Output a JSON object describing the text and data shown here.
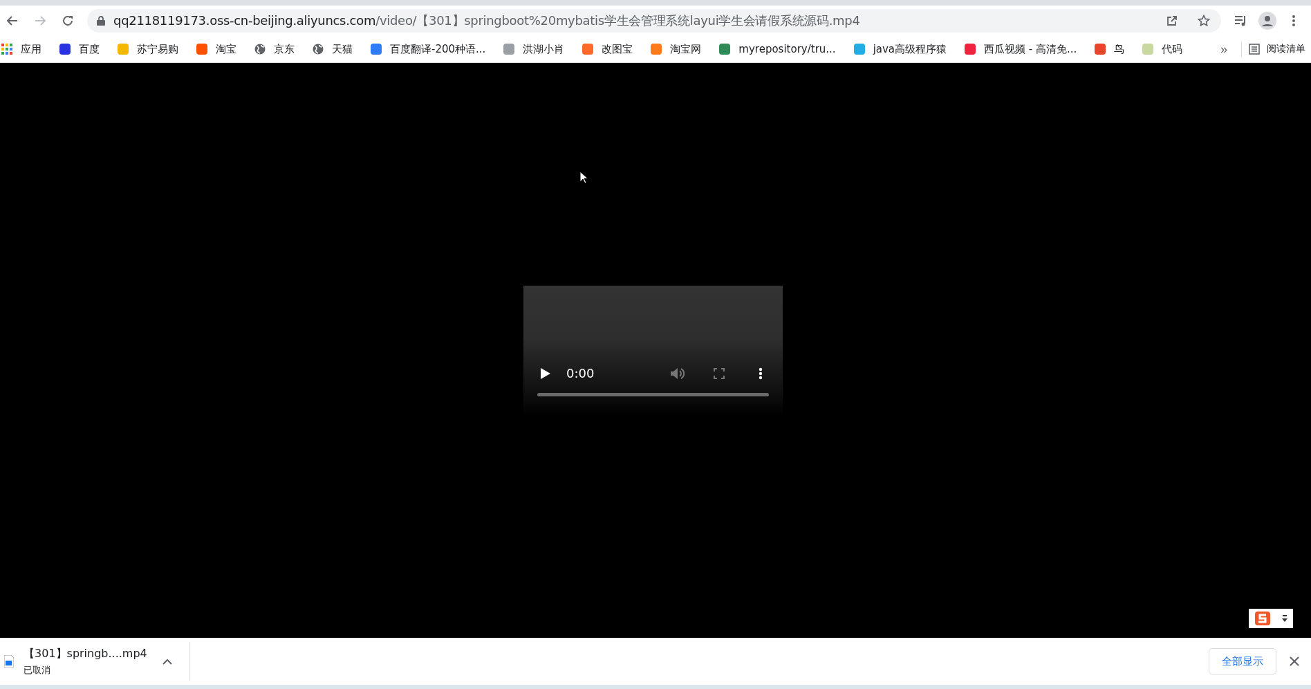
{
  "toolbar": {
    "nav_buttons": [
      {
        "kind": "back",
        "disabled": false
      },
      {
        "kind": "forward",
        "disabled": true
      },
      {
        "kind": "reload",
        "disabled": false
      }
    ],
    "address_bar": {
      "host": "qq2118119173.oss-cn-beijing.aliyuncs.com",
      "path": "/video/【301】springboot%20mybatis学生会管理系统layui学生会请假系统源码.mp4"
    }
  },
  "bookmarks": [
    {
      "label": "应用",
      "kind": "apps"
    },
    {
      "label": "百度",
      "kind": "favicon",
      "color": "#2932e1"
    },
    {
      "label": "苏宁易购",
      "kind": "favicon",
      "color": "#f5b800"
    },
    {
      "label": "淘宝",
      "kind": "favicon",
      "color": "#ff5000"
    },
    {
      "label": "京东",
      "kind": "globe"
    },
    {
      "label": "天猫",
      "kind": "globe"
    },
    {
      "label": "百度翻译-200种语...",
      "kind": "favicon",
      "color": "#2e7cf6"
    },
    {
      "label": "洪湖小肖",
      "kind": "favicon",
      "color": "#9aa0a6"
    },
    {
      "label": "改图宝",
      "kind": "favicon",
      "color": "#ff6a2a"
    },
    {
      "label": "淘宝网",
      "kind": "favicon",
      "color": "#ff7a1a"
    },
    {
      "label": "myrepository/tru...",
      "kind": "favicon",
      "color": "#2e8b57"
    },
    {
      "label": "java高级程序猿",
      "kind": "favicon",
      "color": "#23ade5"
    },
    {
      "label": "西瓜视频 - 高清免...",
      "kind": "favicon",
      "color": "#f0233e"
    },
    {
      "label": "鸟",
      "kind": "favicon",
      "color": "#e8452c"
    },
    {
      "label": "代码",
      "kind": "favicon",
      "color": "#c9d8a0"
    }
  ],
  "bookmarks_overflow": "»",
  "reading_list": "阅读清单",
  "video": {
    "time": "0:00",
    "level": 0
  },
  "download": {
    "filename": "【301】springb....mp4",
    "status": "已取消"
  },
  "show_all_button": "全部显示"
}
